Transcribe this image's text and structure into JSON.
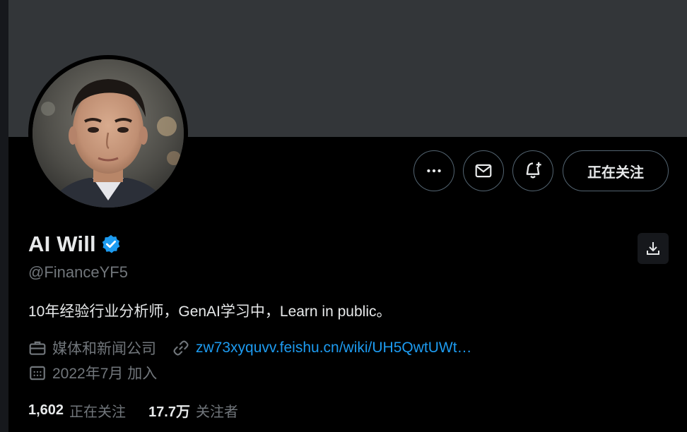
{
  "profile": {
    "name": "AI Will",
    "handle": "@FinanceYF5",
    "bio": "10年经验行业分析师，GenAI学习中，Learn in public。",
    "category": "媒体和新闻公司",
    "link": "zw73xyquvv.feishu.cn/wiki/UH5QwtUWt…",
    "joined": "2022年7月 加入"
  },
  "actions": {
    "more_icon": "more-dots-icon",
    "message_icon": "mail-icon",
    "notify_icon": "bell-plus-icon",
    "follow_label": "正在关注",
    "download_icon": "download-icon"
  },
  "stats": {
    "following_count": "1,602",
    "following_label": "正在关注",
    "followers_count": "17.7万",
    "followers_label": "关注者"
  },
  "colors": {
    "banner": "#333639",
    "background": "#000000",
    "accent": "#1d9bf0",
    "muted": "#71767b"
  }
}
